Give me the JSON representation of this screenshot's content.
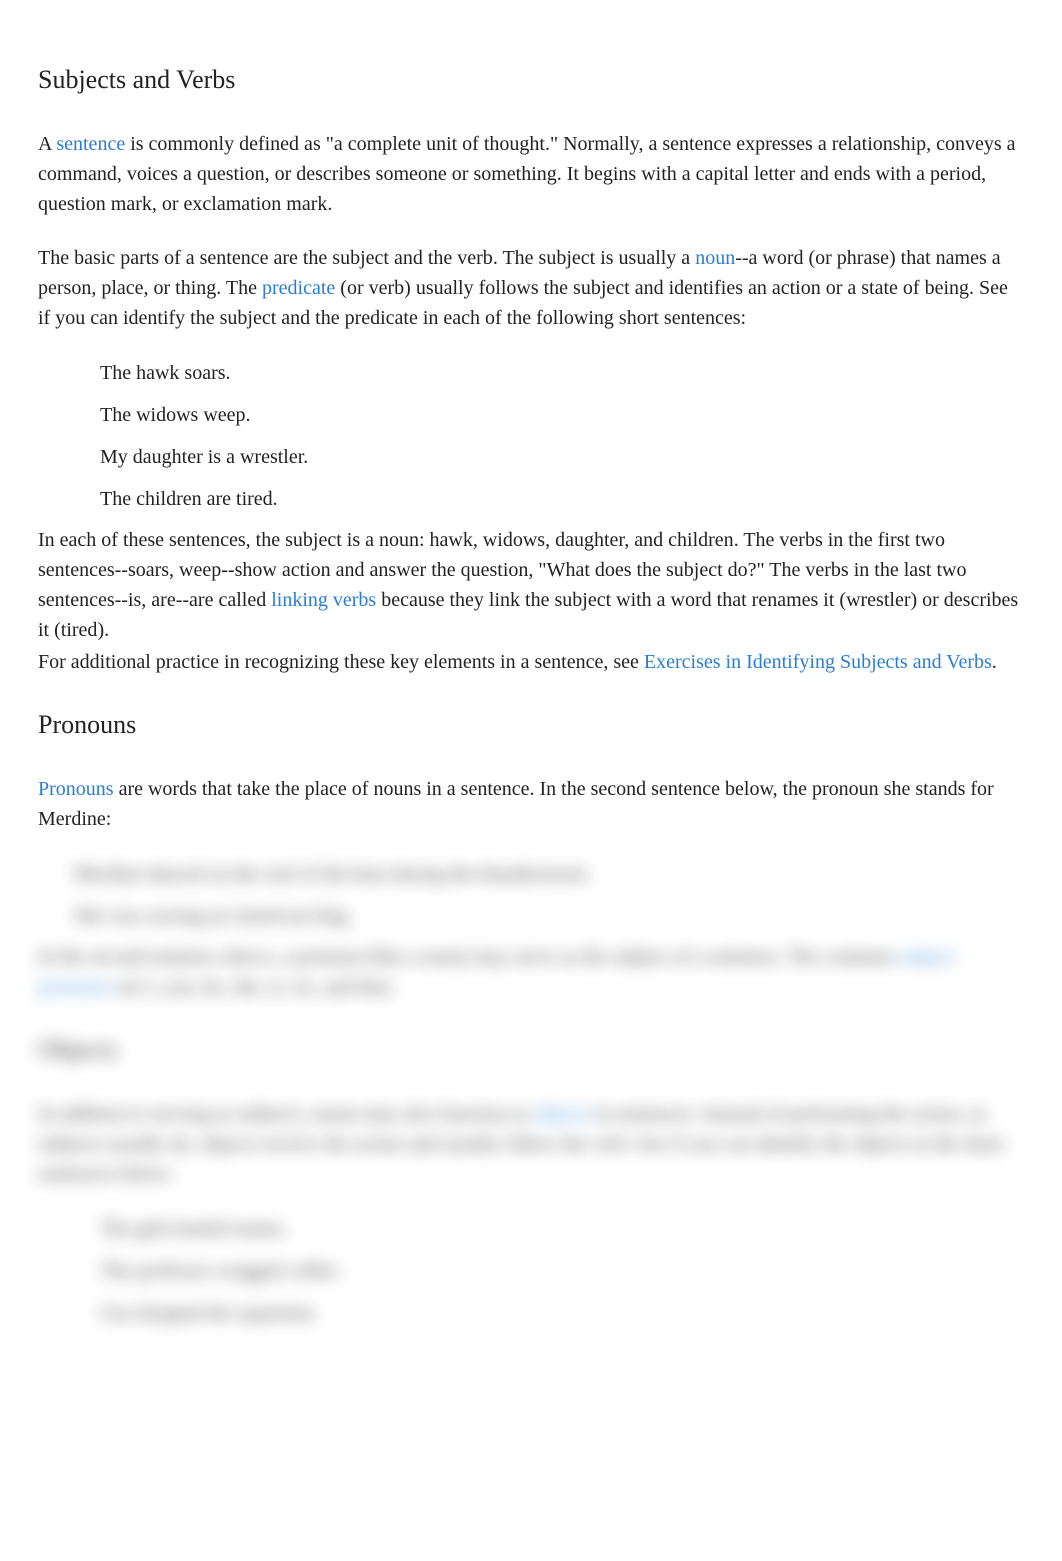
{
  "sections": {
    "subjects_verbs": {
      "heading": "Subjects and Verbs",
      "p1_a": "A ",
      "p1_link1": "sentence",
      "p1_b": " is commonly defined as \"a complete unit of thought.\" Normally, a sentence expresses a relationship, conveys a command, voices a question, or describes someone or something. It begins with a capital letter and ends with a period, question mark, or exclamation mark.",
      "p2_a": "The basic parts of a sentence are the ",
      "p2_i1": "subject",
      "p2_b": " and the ",
      "p2_i2": "verb",
      "p2_c": ". The subject is usually a ",
      "p2_link1": "noun",
      "p2_d": "--a word (or phrase) that names a person, place, or thing. The ",
      "p2_link2": "predicate",
      "p2_e": " (or ",
      "p2_i3": "verb",
      "p2_f": ") usually follows the subject and identifies an action or a state of being. See if you can identify the subject and the predicate in each of the following short sentences:",
      "examples1": [
        "The hawk soars.",
        "The widows weep.",
        "My daughter is a wrestler.",
        "The children are tired."
      ],
      "p3_a": "In each of these sentences, the subject is a noun: ",
      "p3_i1": "hawk, widows, daughter",
      "p3_b": ", and ",
      "p3_i2": "children",
      "p3_c": ". The verbs in the first two sentences--",
      "p3_i3": "soars, weep",
      "p3_d": "--show action and answer the question, \"What does the subject do?\" The verbs in the last two sentences--",
      "p3_i4": "is, are",
      "p3_e": "--are called ",
      "p3_link1": "linking verbs",
      "p3_f": " because they link the subject with a word that renames it (",
      "p3_i5": "wrestler",
      "p3_g": ") or describes it (",
      "p3_i6": "tired",
      "p3_h": ").",
      "p4_a": "For additional practice in recognizing these key elements in a sentence, see ",
      "p4_link1": "Exercises in Identifying Subjects and Verbs",
      "p4_b": "."
    },
    "pronouns": {
      "heading": "Pronouns",
      "p1_link1": "Pronouns",
      "p1_a": " are words that take the place of nouns in a sentence. In the second sentence below, the pronoun ",
      "p1_i1": "she",
      "p1_b": " stands for ",
      "p1_i2": "Merdine",
      "p1_c": ":",
      "examples2": [
        "Merdine danced on the roof of the barn during the thunderstorm.",
        "She was waving an American flag."
      ],
      "p2_a": "In the second sentence above, a pronoun (like a noun) may serve as the subject of a sentence. The common ",
      "p2_link1": "subject pronouns",
      "p2_b": " are ",
      "p2_i1": "I, you, he, she, it, we,",
      "p2_c": " and ",
      "p2_i2": "they",
      "p2_d": "."
    },
    "objects": {
      "heading": "Objects",
      "p1_a": "In addition to serving as subjects, nouns may also function as ",
      "p1_link1": "objects",
      "p1_b": " in sentences. Instead of performing the action, as subjects usually do, objects ",
      "p1_i1": "receive",
      "p1_c": " the action and usually follow the verb. See if you can identify the objects in the short sentences below:",
      "examples3": [
        "The girls hurled stones.",
        "The professor swigged coffee.",
        "Gus dropped the aquarium."
      ]
    }
  }
}
